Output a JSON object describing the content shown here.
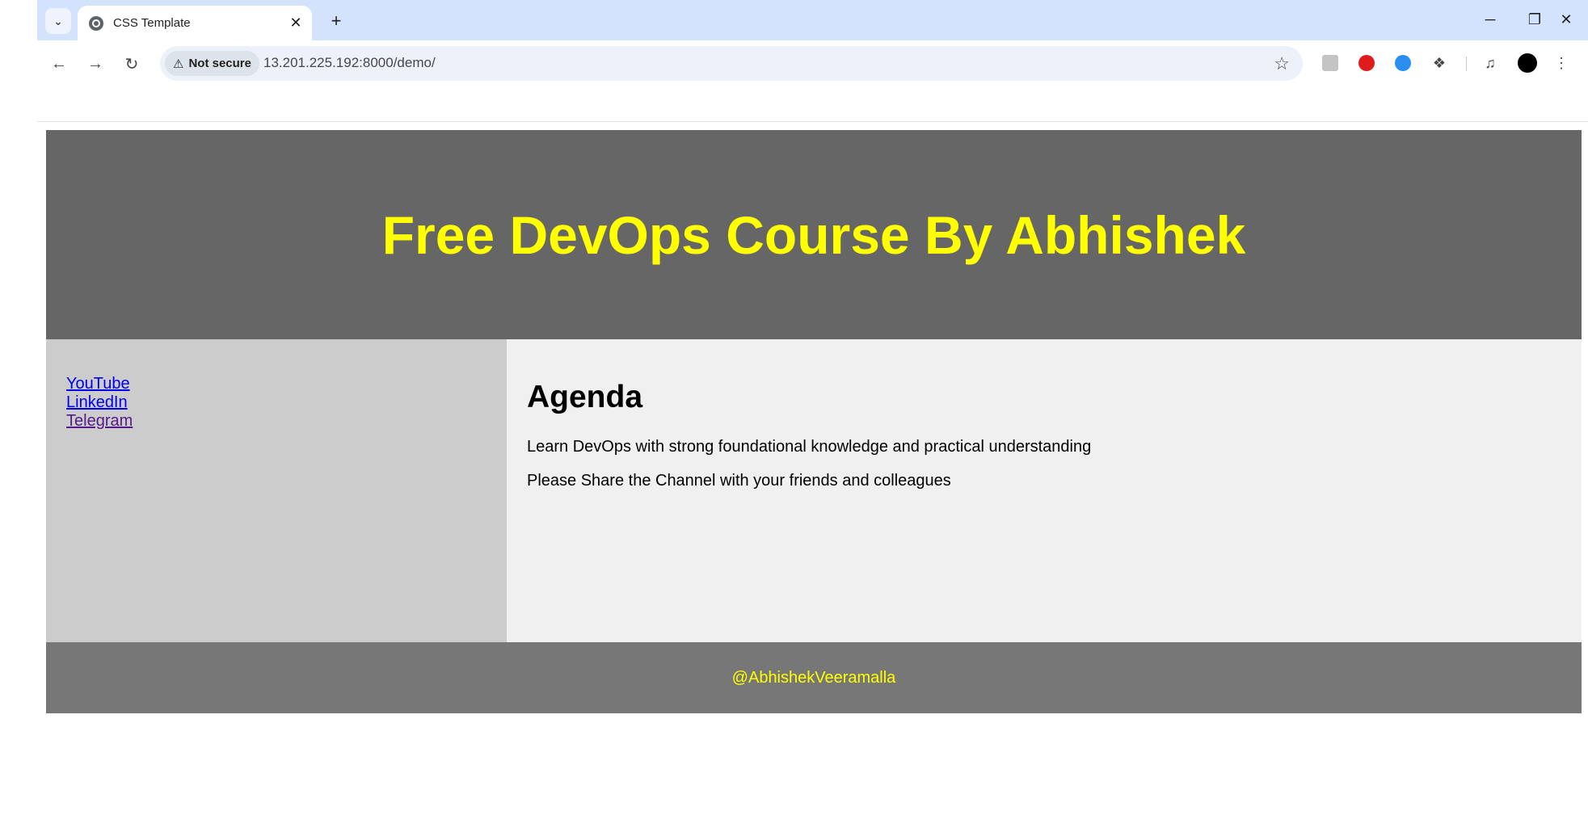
{
  "browser": {
    "tab_title": "CSS Template",
    "security_label": "Not secure",
    "url": "13.201.225.192:8000/demo/"
  },
  "header": {
    "title": "Free DevOps Course By Abhishek"
  },
  "sidebar": {
    "links": [
      {
        "label": "YouTube",
        "state": "normal"
      },
      {
        "label": "LinkedIn",
        "state": "normal"
      },
      {
        "label": "Telegram",
        "state": "visited"
      }
    ]
  },
  "content": {
    "heading": "Agenda",
    "paragraphs": [
      "Learn DevOps with strong foundational knowledge and practical understanding",
      "Please Share the Channel with your friends and colleagues"
    ]
  },
  "footer": {
    "text": "@AbhishekVeeramalla"
  },
  "colors": {
    "header_bg": "#666666",
    "accent_text": "#ffff00",
    "sidebar_bg": "#cccccc",
    "content_bg": "#f0f0f0",
    "footer_bg": "#777777",
    "tabstrip_bg": "#d3e3fd"
  }
}
